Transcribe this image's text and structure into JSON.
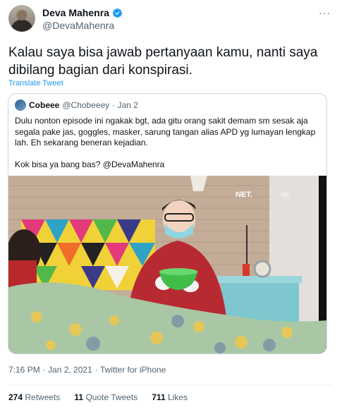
{
  "author": {
    "name": "Deva Mahenra",
    "handle": "@DevaMahenra"
  },
  "more_label": "···",
  "tweet_text": "Kalau saya bisa jawab pertanyaan kamu, nanti saya dibilang bagian dari konspirasi.",
  "translate_label": "Translate Tweet",
  "quote": {
    "name": "Cobeee",
    "handle": "@Chobeeey",
    "date": "· Jan 2",
    "paragraph1": "Dulu nonton episode ini ngakak bgt, ada gitu orang sakit demam sm sesak aja segala pake jas, goggles, masker, sarung tangan alias APD yg lumayan lengkap lah. Eh sekarang beneran kejadian.",
    "paragraph2": "Kok bisa ya bang bas? @DevaMahenra",
    "media_watermark": "NET.",
    "media_hd": "HD"
  },
  "meta": {
    "time": "7:16 PM",
    "date": "· Jan 2, 2021",
    "source": "· Twitter for iPhone"
  },
  "stats": {
    "retweets_count": "274",
    "retweets_label": "Retweets",
    "quotes_count": "11",
    "quotes_label": "Quote Tweets",
    "likes_count": "711",
    "likes_label": "Likes"
  },
  "colors": {
    "link": "#1d9bf0",
    "text": "#0f1419",
    "muted": "#536471",
    "border": "#cfd9de",
    "verified": "#1d9bf0"
  }
}
